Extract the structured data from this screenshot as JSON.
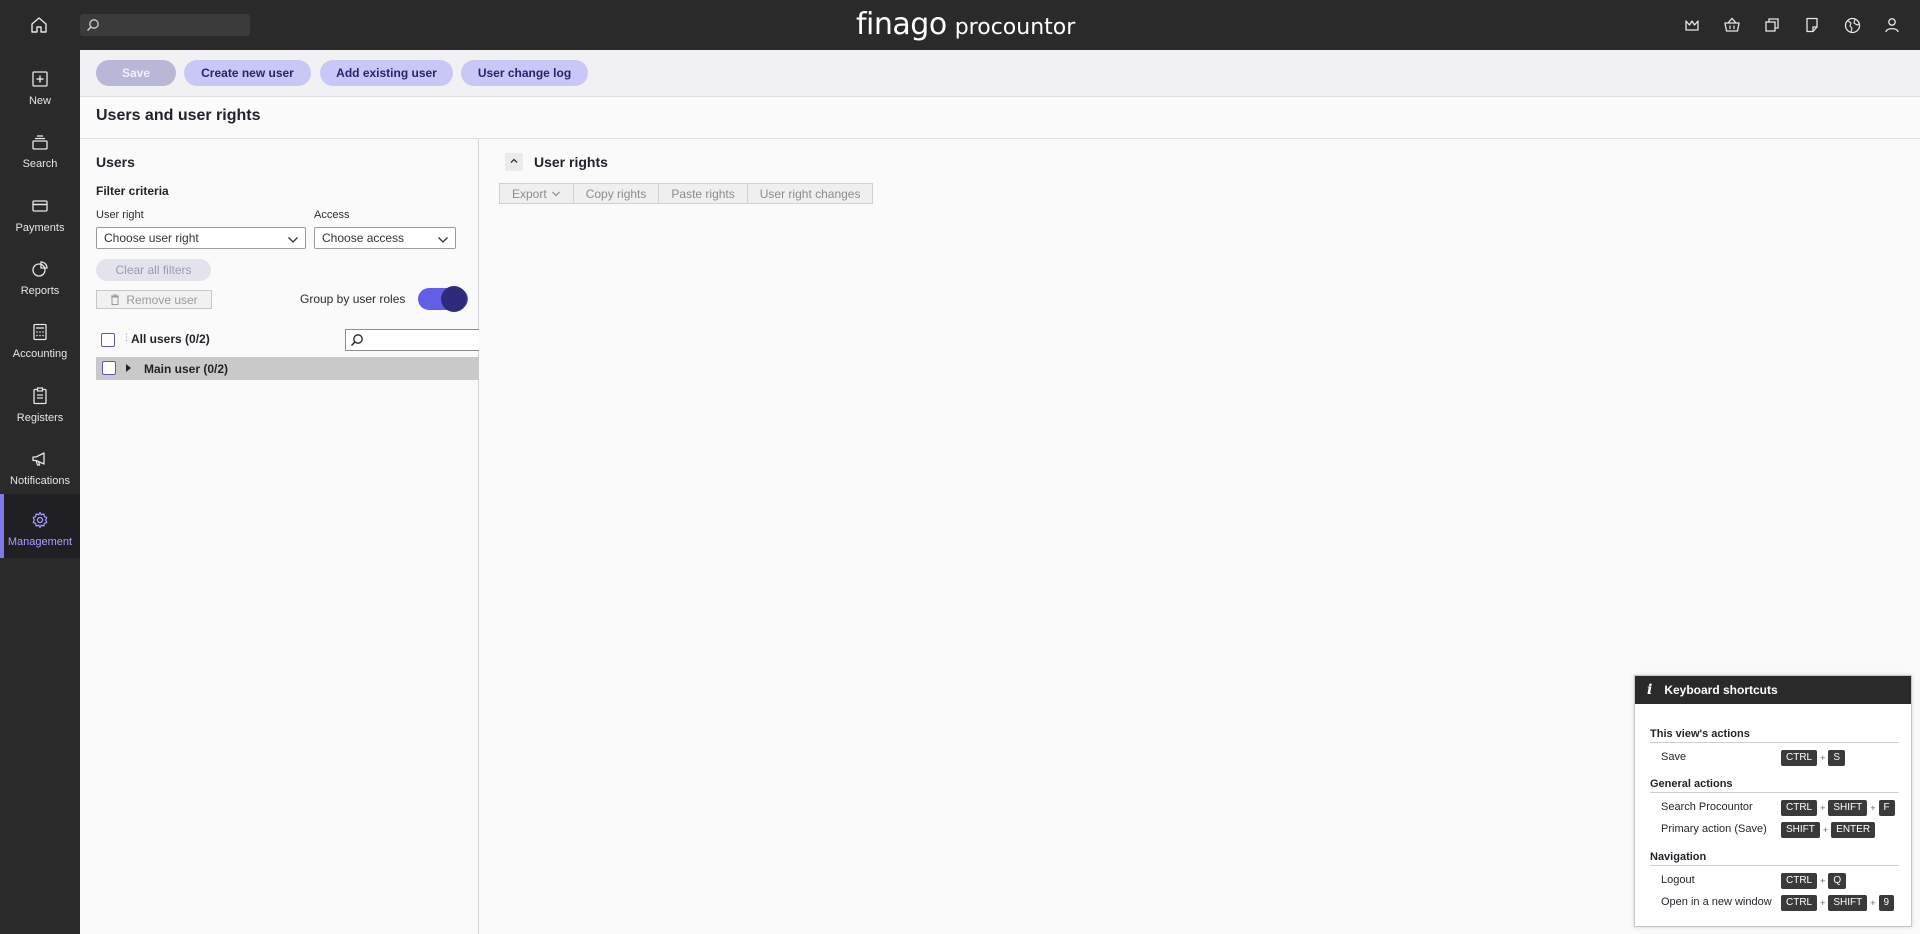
{
  "header": {
    "brand_primary": "finago",
    "brand_secondary": "procountor",
    "icons": [
      "crown-icon",
      "basket-icon",
      "windows-icon",
      "document-icon",
      "globe-icon",
      "user-icon"
    ]
  },
  "sidenav": {
    "items": [
      {
        "label": "New",
        "icon": "plus-square-icon"
      },
      {
        "label": "Search",
        "icon": "stack-icon"
      },
      {
        "label": "Payments",
        "icon": "card-icon"
      },
      {
        "label": "Reports",
        "icon": "pie-chart-icon"
      },
      {
        "label": "Accounting",
        "icon": "calculator-icon"
      },
      {
        "label": "Registers",
        "icon": "clipboard-icon"
      },
      {
        "label": "Notifications",
        "icon": "megaphone-icon"
      },
      {
        "label": "Management",
        "icon": "gear-icon",
        "active": true
      }
    ]
  },
  "toolbar": {
    "save_label": "Save",
    "create_label": "Create new user",
    "add_existing_label": "Add existing user",
    "change_log_label": "User change log"
  },
  "page": {
    "title": "Users and user rights"
  },
  "users_panel": {
    "title": "Users",
    "filter_title": "Filter criteria",
    "user_right_label": "User right",
    "user_right_value": "Choose user right",
    "access_label": "Access",
    "access_value": "Choose access",
    "clear_filters_label": "Clear all filters",
    "remove_user_label": "Remove user",
    "group_by_label": "Group by user roles",
    "group_by_enabled": true,
    "all_users_label": "All users (0/2)",
    "groups": [
      {
        "label": "Main user (0/2)"
      }
    ]
  },
  "rights_panel": {
    "title": "User rights",
    "tools": {
      "export": "Export",
      "copy": "Copy rights",
      "paste": "Paste rights",
      "changes": "User right changes"
    }
  },
  "shortcuts": {
    "title": "Keyboard shortcuts",
    "sections": {
      "view": "This view's actions",
      "general": "General actions",
      "navigation": "Navigation"
    },
    "rows": {
      "save": {
        "name": "Save",
        "keys": [
          "CTRL",
          "S"
        ]
      },
      "search": {
        "name": "Search Procountor",
        "keys": [
          "CTRL",
          "SHIFT",
          "F"
        ]
      },
      "primary": {
        "name": "Primary action (Save)",
        "keys": [
          "SHIFT",
          "ENTER"
        ]
      },
      "logout": {
        "name": "Logout",
        "keys": [
          "CTRL",
          "Q"
        ]
      },
      "newwin": {
        "name": "Open in a new window",
        "keys": [
          "CTRL",
          "SHIFT",
          "9"
        ]
      }
    },
    "plus_sign": "+"
  }
}
